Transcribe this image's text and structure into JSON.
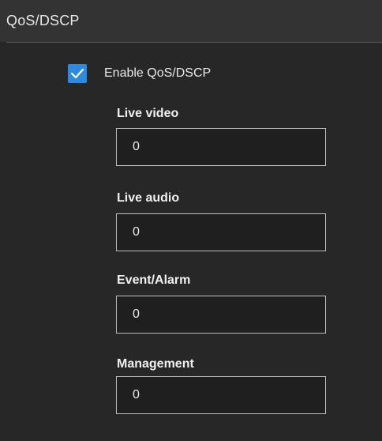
{
  "section": {
    "title": "QoS/DSCP"
  },
  "enable": {
    "label": "Enable QoS/DSCP",
    "checked": true
  },
  "fields": [
    {
      "label": "Live video",
      "value": "0"
    },
    {
      "label": "Live audio",
      "value": "0"
    },
    {
      "label": "Event/Alarm",
      "value": "0"
    },
    {
      "label": "Management",
      "value": "0"
    }
  ],
  "colors": {
    "accent": "#2e8ae0",
    "background": "#272727"
  }
}
